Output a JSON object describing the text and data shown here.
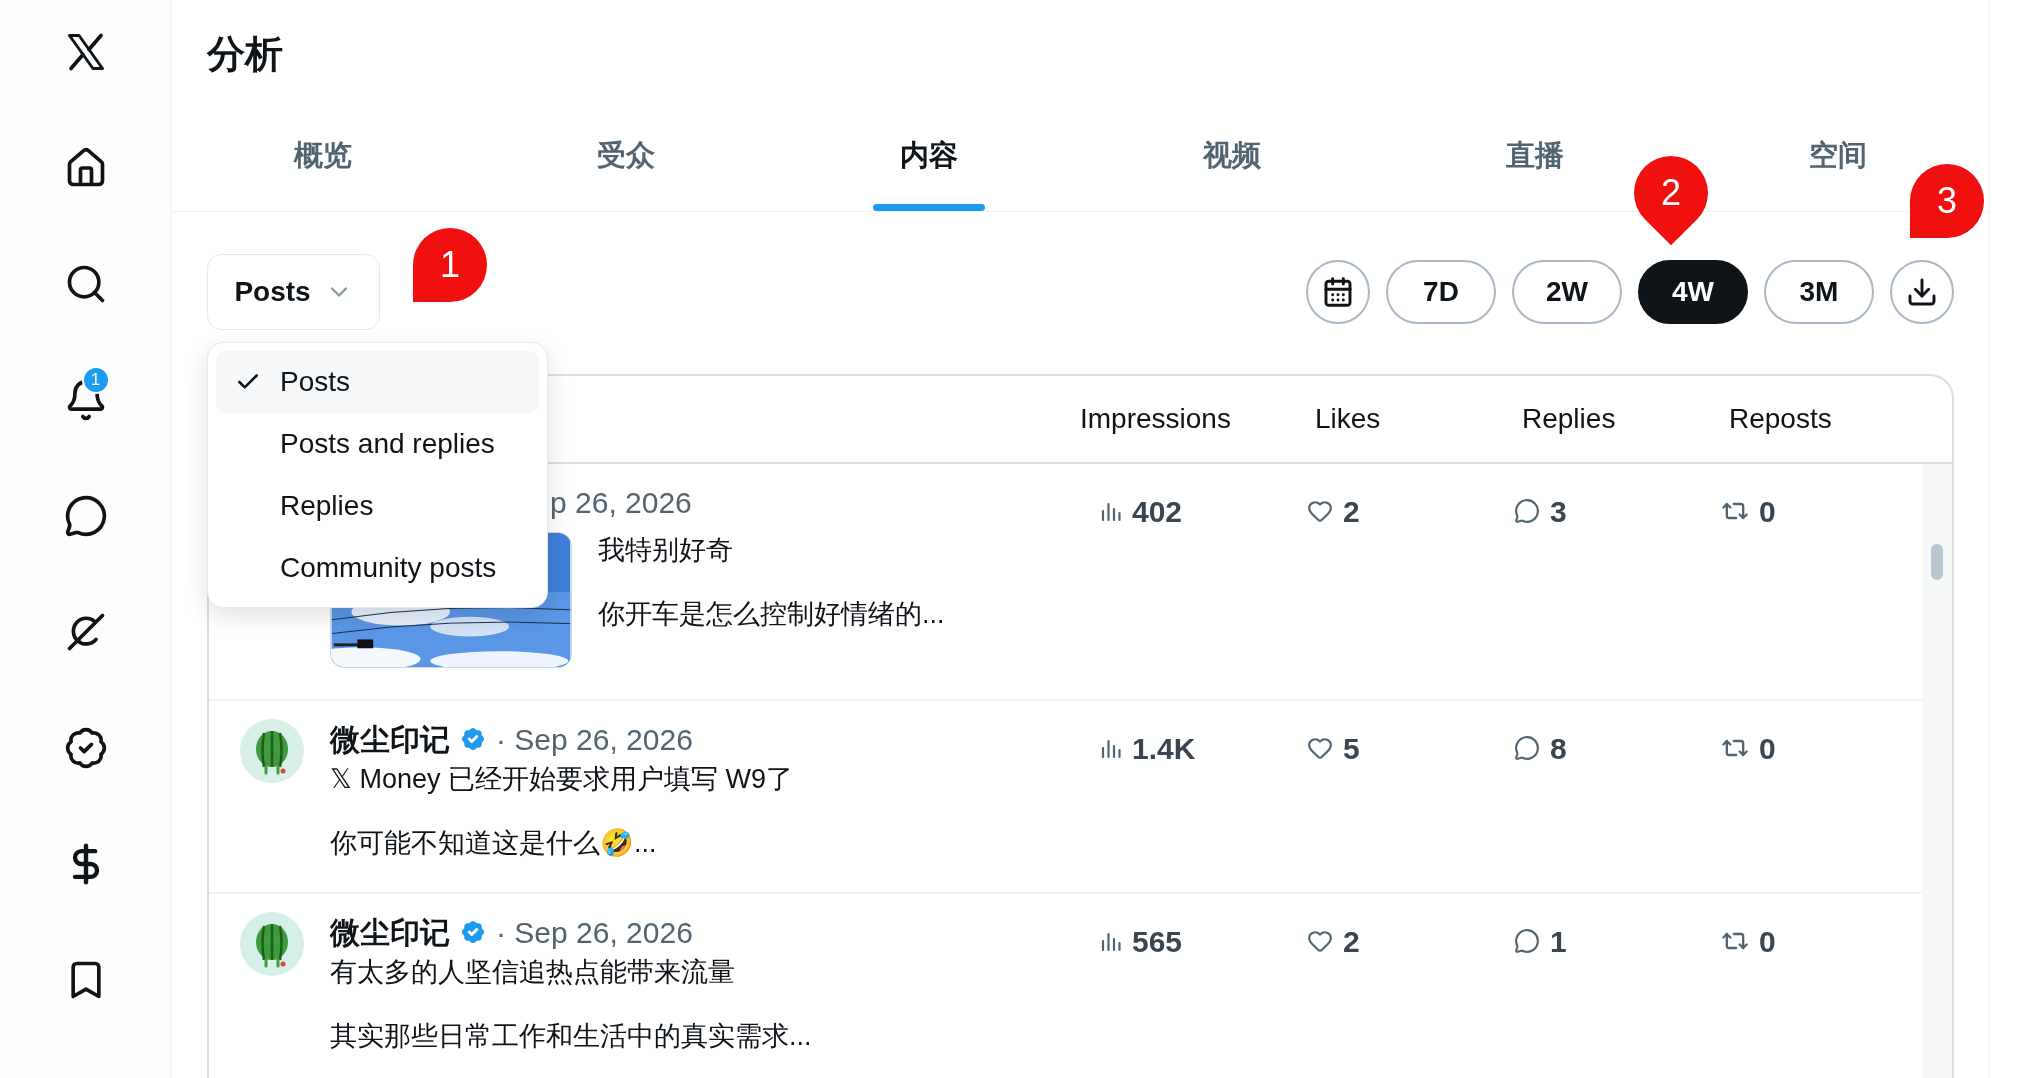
{
  "sidebar": {
    "notification_badge": "1"
  },
  "page_title": "分析",
  "tabs": [
    {
      "label": "概览",
      "selected": false
    },
    {
      "label": "受众",
      "selected": false
    },
    {
      "label": "内容",
      "selected": true
    },
    {
      "label": "视频",
      "selected": false
    },
    {
      "label": "直播",
      "selected": false
    },
    {
      "label": "空间",
      "selected": false
    }
  ],
  "filter": {
    "value": "Posts",
    "menu": [
      {
        "label": "Posts",
        "selected": true
      },
      {
        "label": "Posts and replies",
        "selected": false
      },
      {
        "label": "Replies",
        "selected": false
      },
      {
        "label": "Community posts",
        "selected": false
      }
    ]
  },
  "ranges": [
    {
      "label": "7D",
      "selected": false
    },
    {
      "label": "2W",
      "selected": false
    },
    {
      "label": "4W",
      "selected": true
    },
    {
      "label": "3M",
      "selected": false
    }
  ],
  "callouts": [
    {
      "label": "1"
    },
    {
      "label": "2"
    },
    {
      "label": "3"
    }
  ],
  "table": {
    "columns": [
      "Impressions",
      "Likes",
      "Replies",
      "Reposts"
    ],
    "rows": [
      {
        "kind": "with_image",
        "date": "p 26, 2026",
        "text": [
          "我特别好奇",
          "你开车是怎么控制好情绪的..."
        ],
        "impressions": "402",
        "likes": "2",
        "replies": "3",
        "reposts": "0"
      },
      {
        "kind": "text",
        "author": "微尘印记",
        "verified": true,
        "date": "· Sep 26, 2026",
        "text": [
          "𝕏 Money 已经开始要求用户填写 W9了",
          "你可能不知道这是什么🤣..."
        ],
        "impressions": "1.4K",
        "likes": "5",
        "replies": "8",
        "reposts": "0"
      },
      {
        "kind": "text",
        "author": "微尘印记",
        "verified": true,
        "date": "· Sep 26, 2026",
        "text": [
          "有太多的人坚信追热点能带来流量",
          "其实那些日常工作和生活中的真实需求..."
        ],
        "impressions": "565",
        "likes": "2",
        "replies": "1",
        "reposts": "0"
      }
    ]
  }
}
